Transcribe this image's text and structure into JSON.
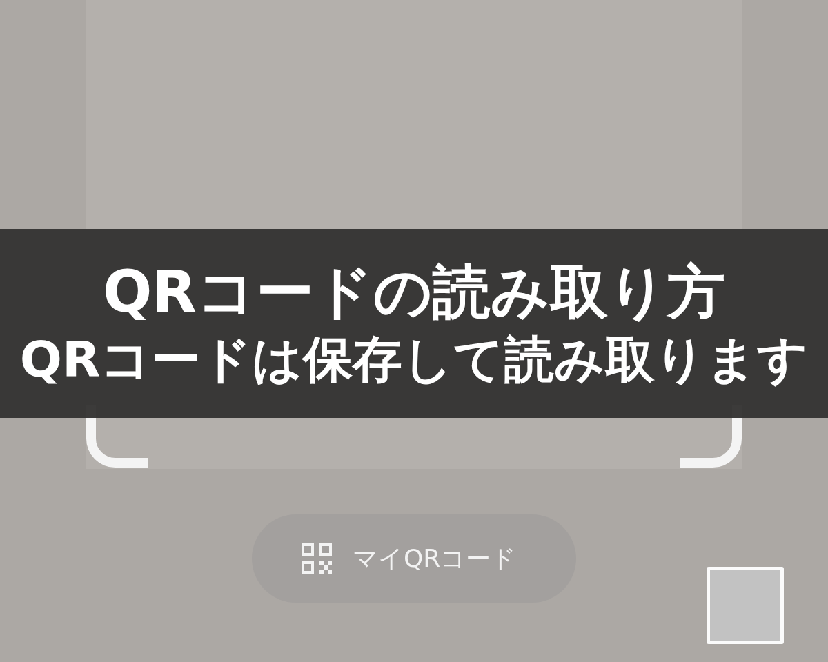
{
  "banner": {
    "title": "QRコードの読み取り方",
    "subtitle": "QRコードは保存して読み取ります"
  },
  "my_qr_button": {
    "label": "マイQRコード"
  }
}
